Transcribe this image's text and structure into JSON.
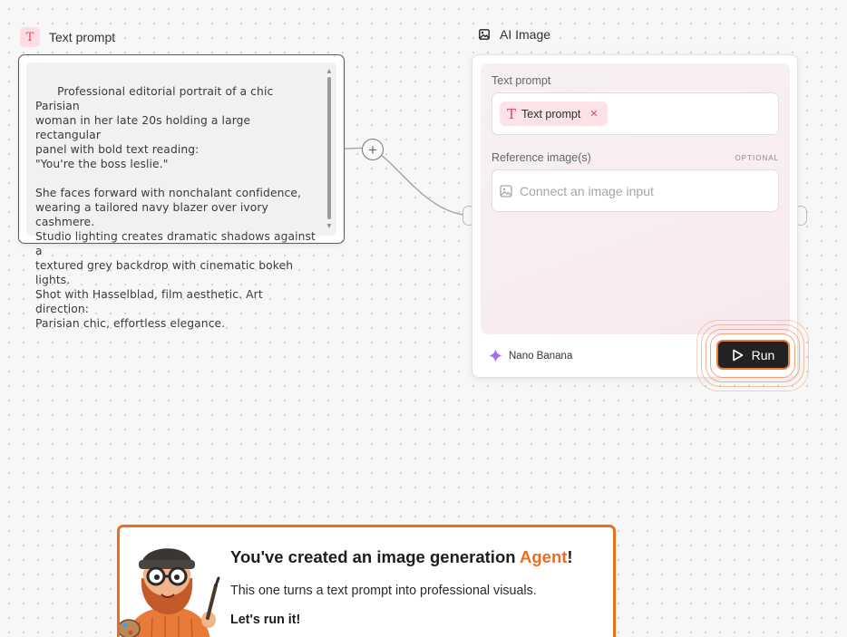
{
  "text_node": {
    "title": "Text prompt",
    "icon": "text-icon",
    "content": "Professional editorial portrait of a chic Parisian\nwoman in her late 20s holding a large rectangular\npanel with bold text reading:\n\"You're the boss leslie.\"\n\nShe faces forward with nonchalant confidence,\nwearing a tailored navy blazer over ivory cashmere.\nStudio lighting creates dramatic shadows against a\ntextured grey backdrop with cinematic bokeh lights.\nShot with Hasselblad, film aesthetic. Art direction:\nParisian chic, effortless elegance."
  },
  "ai_node": {
    "title": "AI Image",
    "icon": "image-icon",
    "text_prompt_label": "Text prompt",
    "chip_label": "Text prompt",
    "chip_icon": "text-icon",
    "reference_label": "Reference image(s)",
    "optional_label": "OPTIONAL",
    "reference_placeholder": "Connect an image input",
    "model_name": "Nano Banana",
    "run_label": "Run"
  },
  "tutorial": {
    "title_prefix": "You've created an image generation ",
    "title_accent": "Agent",
    "title_suffix": "!",
    "body": "This one turns a text prompt into professional visuals.",
    "cta": "Let's run it!"
  },
  "colors": {
    "accent": "#ec6b1f",
    "text_pink": "#e0466b",
    "run_bg": "#222222"
  }
}
